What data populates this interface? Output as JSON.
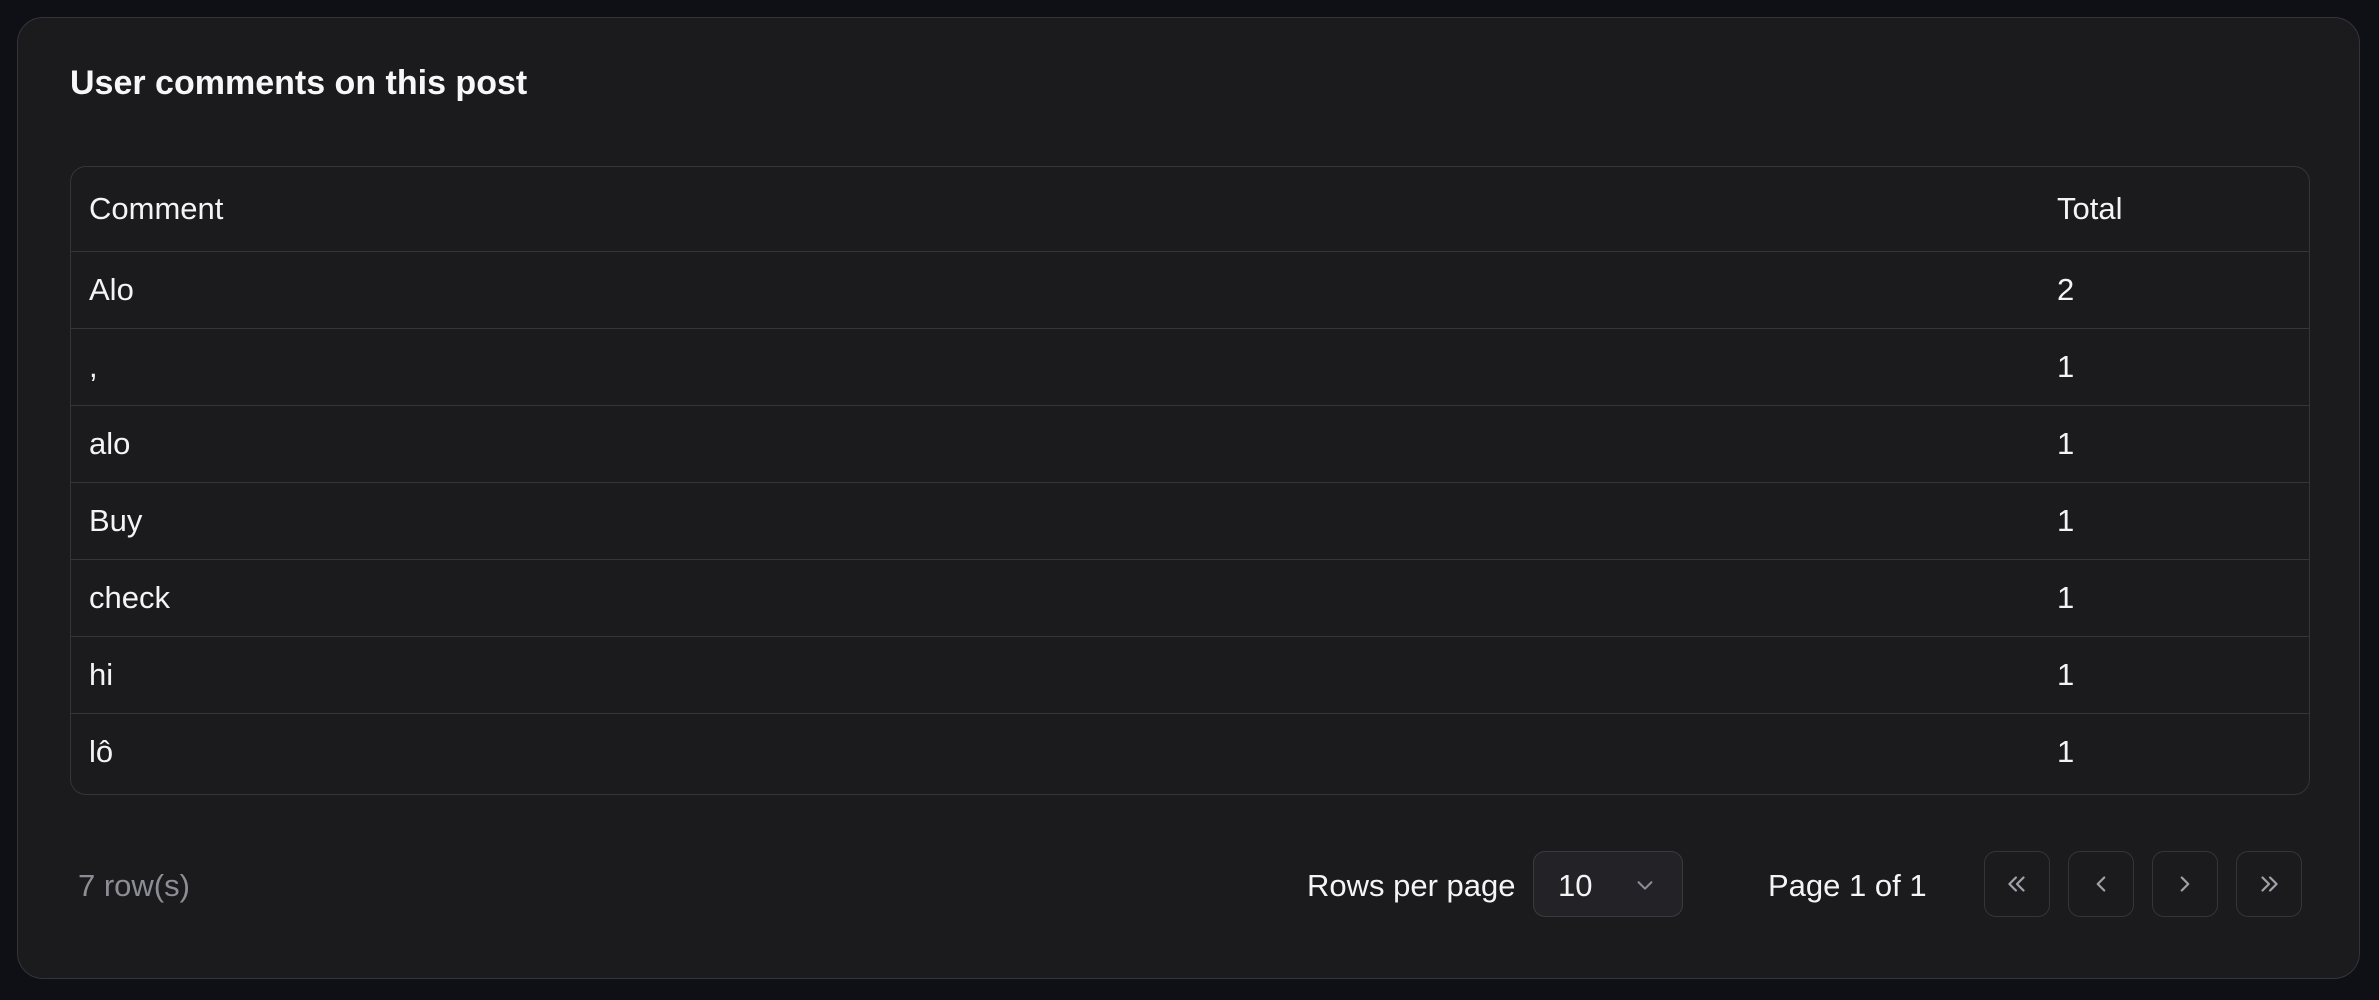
{
  "card": {
    "title": "User comments on this post"
  },
  "table": {
    "headers": {
      "comment": "Comment",
      "total": "Total"
    },
    "rows": [
      {
        "comment": "Alo",
        "total": "2"
      },
      {
        "comment": ",",
        "total": "1"
      },
      {
        "comment": "alo",
        "total": "1"
      },
      {
        "comment": "Buy",
        "total": "1"
      },
      {
        "comment": "check",
        "total": "1"
      },
      {
        "comment": "hi",
        "total": "1"
      },
      {
        "comment": "lô",
        "total": "1"
      }
    ]
  },
  "footer": {
    "row_count": "7 row(s)",
    "rows_per_page_label": "Rows per page",
    "rows_per_page_value": "10",
    "page_info": "Page 1 of 1"
  },
  "icons": {
    "select": "chevron-down-icon",
    "first": "chevrons-left-icon",
    "prev": "chevron-left-icon",
    "next": "chevron-right-icon",
    "last": "chevrons-right-icon"
  },
  "colors": {
    "page_background": "#0f1015",
    "card_background": "#1b1b1e",
    "border": "#34343a",
    "text_primary": "#f4f4f5",
    "text_muted": "#8d8d95"
  }
}
